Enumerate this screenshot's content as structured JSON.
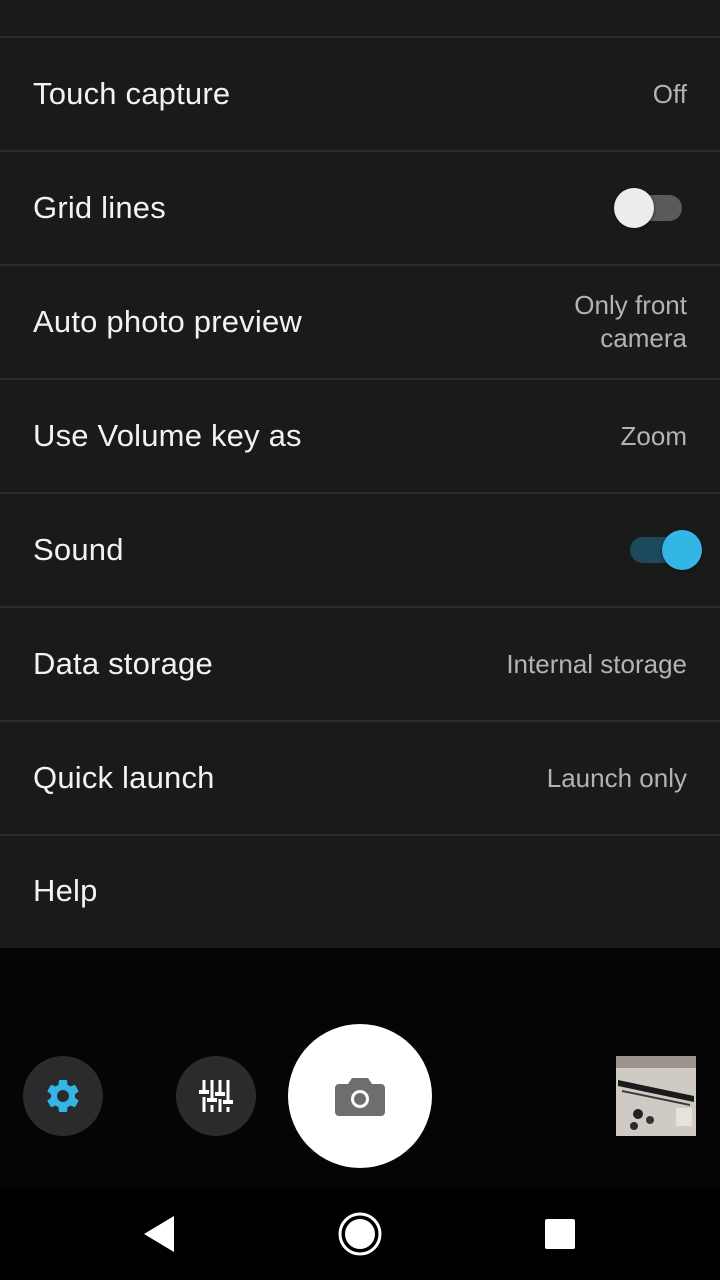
{
  "settings": {
    "rows": [
      {
        "label": "Touch capture",
        "value": "Off"
      },
      {
        "label": "Grid lines",
        "toggle": false
      },
      {
        "label": "Auto photo preview",
        "value_line1": "Only front",
        "value_line2": "camera"
      },
      {
        "label": "Use Volume key as",
        "value": "Zoom"
      },
      {
        "label": "Sound",
        "toggle": true
      },
      {
        "label": "Data storage",
        "value": "Internal storage"
      },
      {
        "label": "Quick launch",
        "value": "Launch only"
      },
      {
        "label": "Help"
      }
    ]
  },
  "controls": {
    "settings_icon": "gear-icon",
    "filters_icon": "sliders-icon",
    "shutter_icon": "camera-icon",
    "accent_color": "#33b5e5"
  },
  "navbar": {
    "back_icon": "back-triangle-icon",
    "home_icon": "home-circle-icon",
    "recents_icon": "recents-square-icon"
  }
}
